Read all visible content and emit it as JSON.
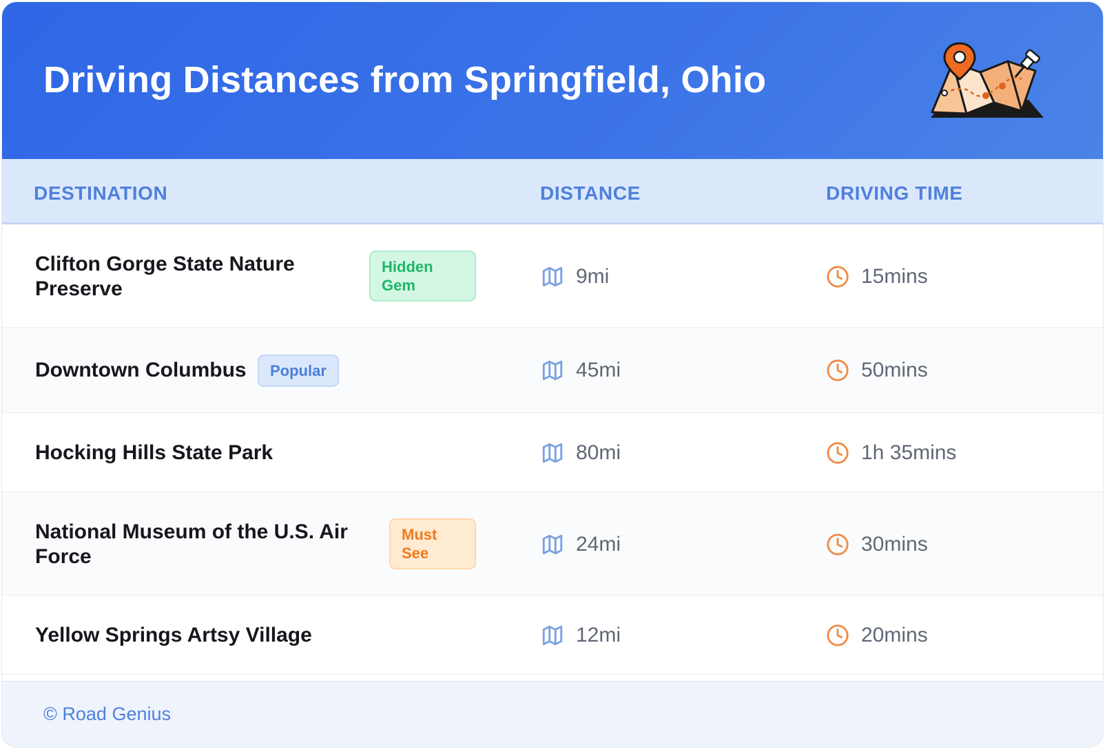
{
  "header": {
    "title": "Driving Distances from Springfield, Ohio",
    "illustration_icon": "map-pin-illustration",
    "gradient": [
      "#2f66e6",
      "#4a83e6"
    ]
  },
  "table": {
    "columns": {
      "destination": "DESTINATION",
      "distance": "DISTANCE",
      "time": "DRIVING TIME"
    },
    "distance_icon": "map-icon",
    "time_icon": "clock-icon",
    "rows": [
      {
        "destination": "Clifton Gorge State Nature Preserve",
        "badge": "Hidden Gem",
        "badge_color": "green",
        "distance": "9mi",
        "time": "15mins"
      },
      {
        "destination": "Downtown Columbus",
        "badge": "Popular",
        "badge_color": "blue",
        "distance": "45mi",
        "time": "50mins"
      },
      {
        "destination": "Hocking Hills State Park",
        "badge": "",
        "badge_color": "",
        "distance": "80mi",
        "time": "1h 35mins"
      },
      {
        "destination": "National Museum of the U.S. Air Force",
        "badge": "Must See",
        "badge_color": "orange",
        "distance": "24mi",
        "time": "30mins"
      },
      {
        "destination": "Yellow Springs Artsy Village",
        "badge": "",
        "badge_color": "",
        "distance": "12mi",
        "time": "20mins"
      }
    ]
  },
  "footer": {
    "copyright": "© Road Genius"
  },
  "colors": {
    "accent": "#4f80db",
    "header_bg": "#2f66e6",
    "table_header_bg": "#dbe8fc",
    "time_icon": "#f08a46",
    "map_icon": "#7aa0e0"
  }
}
